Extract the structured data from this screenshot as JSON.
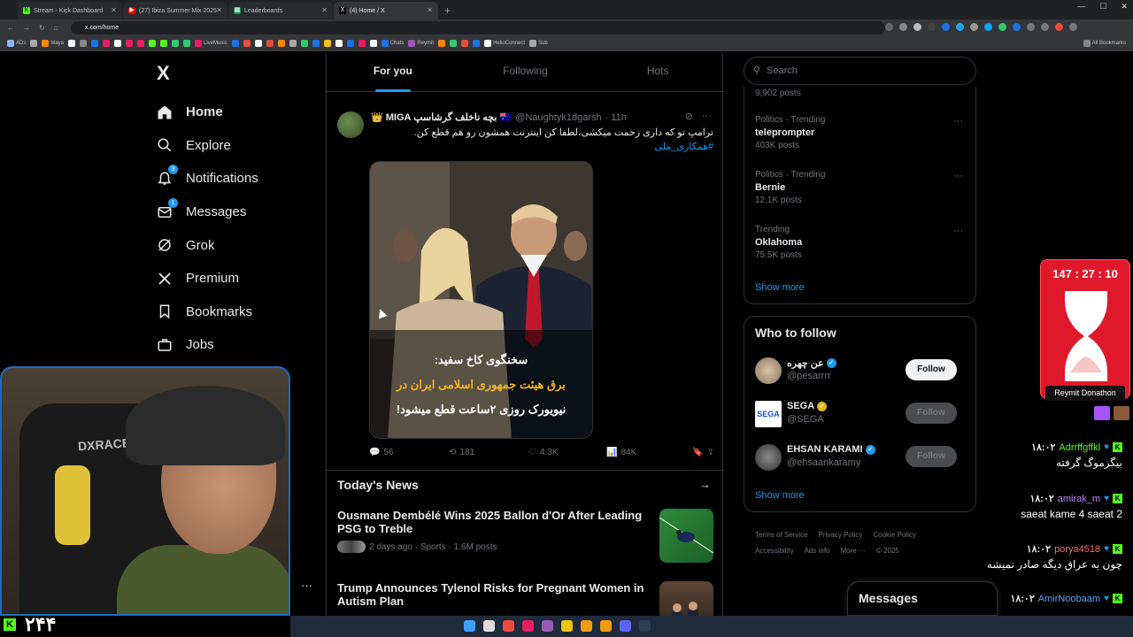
{
  "browser": {
    "tabs": [
      {
        "title": "Stream - Kick Dashboard",
        "color": "#53fc18",
        "glyph": "K"
      },
      {
        "title": "(27) Ibiza Summer Mix 2025",
        "color": "#ff0000",
        "glyph": "▶"
      },
      {
        "title": "Leaderboards",
        "color": "#0f9d58",
        "glyph": "▦"
      },
      {
        "title": "(4) Home / X",
        "color": "#000000",
        "glyph": "X"
      }
    ],
    "url": "x.com/home",
    "bookmarks": [
      "ADs",
      "Maya",
      "LiveMusic",
      "Chats",
      "Reymit",
      "HelioConnect",
      "Sub"
    ],
    "all_bookmarks": "All Bookmarks"
  },
  "nav": {
    "logo": "X",
    "items": [
      {
        "label": "Home",
        "icon": "home-icon",
        "glyph": "⌂",
        "badge": ""
      },
      {
        "label": "Explore",
        "icon": "search-icon",
        "glyph": "⚲",
        "badge": ""
      },
      {
        "label": "Notifications",
        "icon": "bell-icon",
        "glyph": "🔔",
        "badge": "3"
      },
      {
        "label": "Messages",
        "icon": "mail-icon",
        "glyph": "✉",
        "badge": "1"
      },
      {
        "label": "Grok",
        "icon": "grok-icon",
        "glyph": "⊘",
        "badge": ""
      },
      {
        "label": "Premium",
        "icon": "x-icon",
        "glyph": "𝕏",
        "badge": ""
      },
      {
        "label": "Bookmarks",
        "icon": "bookmark-icon",
        "glyph": "🔖",
        "badge": ""
      },
      {
        "label": "Jobs",
        "icon": "briefcase-icon",
        "glyph": "💼",
        "badge": ""
      }
    ],
    "more": "···"
  },
  "feed": {
    "tabs": [
      "For you",
      "Following",
      "Hots"
    ],
    "post": {
      "name": "👑 MIGA بچه ناخلف گرشاسپ 🇦🇺",
      "handle": "@Naughtyk1dgarsh",
      "time": "· 11h",
      "text": "ترامپ تو که داری زحمت میکشی،لطفا کن اینترنت همشون رو هم قطع کن.",
      "hashtag": "#همکاری_ملی",
      "caption_lines": [
        "سخنگوی کاخ سفید:",
        "برق هیئت جمهوری اسلامی ایران در",
        "نیویورک روزی ۲ساعت قطع میشود!"
      ],
      "stats": {
        "replies": "56",
        "reposts": "181",
        "likes": "4.3K",
        "views": "84K"
      }
    },
    "news_title": "Today's News",
    "news": [
      {
        "title": "Ousmane Dembélé Wins 2025 Ballon d'Or After Leading PSG to Treble",
        "meta": "2 days ago · Sports · 1.6M posts"
      },
      {
        "title": "Trump Announces Tylenol Risks for Pregnant Women in Autism Plan",
        "meta": ""
      }
    ]
  },
  "sidebar": {
    "search_placeholder": "Search",
    "first_count": "9,902 posts",
    "trends": [
      {
        "category": "Politics · Trending",
        "name": "teleprompter",
        "posts": "403K posts"
      },
      {
        "category": "Politics · Trending",
        "name": "Bernie",
        "posts": "12.1K posts"
      },
      {
        "category": "Trending",
        "name": "Oklahoma",
        "posts": "75.5K posts"
      }
    ],
    "show_more": "Show more",
    "who_to_follow": "Who to follow",
    "follow": [
      {
        "name": "عن چهره",
        "handle": "@pesarrrr",
        "verified": "#1d9bf0",
        "button": "Follow"
      },
      {
        "name": "SEGA",
        "handle": "@SEGA",
        "verified": "#e2b719",
        "button": "Follow"
      },
      {
        "name": "EHSAN KARAMI",
        "handle": "@ehsaankaramy",
        "verified": "#1d9bf0",
        "button": "Follow"
      }
    ],
    "footer": [
      "Terms of Service",
      "Privacy Policy",
      "Cookie Policy",
      "Accessibility",
      "Ads info",
      "More ···",
      "© 2025"
    ],
    "messages_dock": "Messages"
  },
  "stream": {
    "viewer_count": "۲۴۴",
    "cam_brand": "DXRACER",
    "timer": "147 : 27 : 10",
    "timer_label": "Reymit Donathon",
    "chat": [
      {
        "time": "۱۸:۰۲",
        "user": "Adrrffgffkl",
        "text": "بیگزموگ گرفته",
        "ltr": false
      },
      {
        "time": "۱۸:۰۲",
        "user": "amirak_m",
        "text": "saeat kame 4 saeat 2",
        "ltr": true
      },
      {
        "time": "۱۸:۰۲",
        "user": "porya4518",
        "text": "چون به عراق دیگه صادر نمیشه",
        "ltr": false
      },
      {
        "time": "۱۸:۰۲",
        "user": "AmirNoobaam",
        "text": "",
        "ltr": false
      }
    ]
  }
}
